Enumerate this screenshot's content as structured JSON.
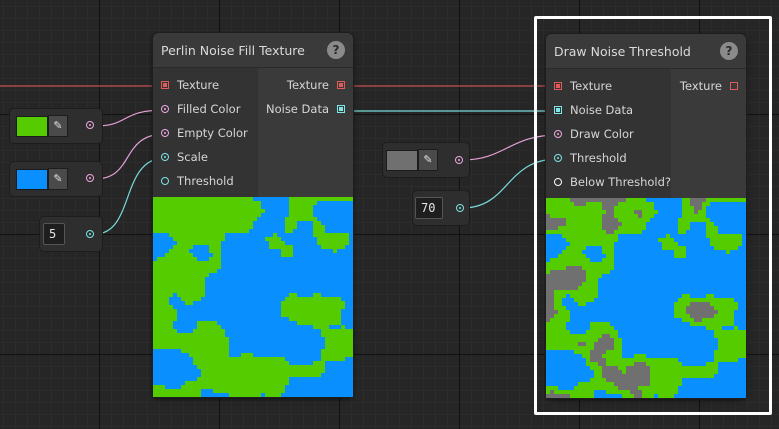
{
  "colors": {
    "texture": "#e05a5a",
    "noise": "#7ee6e6",
    "color": "#f0a8e0",
    "float": "#7ee6e6",
    "wire_texture": "#c45050",
    "wire_noise": "#78dada",
    "wire_color": "#e6a0d8",
    "fill_green": "#55cc00",
    "fill_blue": "#0a8fff",
    "fill_gray": "#707070"
  },
  "node_perlin": {
    "title": "Perlin Noise Fill Texture",
    "help_icon": "?",
    "inputs": [
      {
        "label": "Texture",
        "type": "texture"
      },
      {
        "label": "Filled Color",
        "type": "color"
      },
      {
        "label": "Empty Color",
        "type": "color"
      },
      {
        "label": "Scale",
        "type": "float"
      },
      {
        "label": "Threshold",
        "type": "float_empty"
      }
    ],
    "outputs": [
      {
        "label": "Texture",
        "type": "texture"
      },
      {
        "label": "Noise Data",
        "type": "noise"
      }
    ]
  },
  "node_threshold": {
    "title": "Draw Noise Threshold",
    "help_icon": "?",
    "inputs": [
      {
        "label": "Texture",
        "type": "texture"
      },
      {
        "label": "Noise Data",
        "type": "noise"
      },
      {
        "label": "Draw Color",
        "type": "color"
      },
      {
        "label": "Threshold",
        "type": "float"
      },
      {
        "label": "Below Threshold?",
        "type": "bool"
      }
    ],
    "outputs": [
      {
        "label": "Texture",
        "type": "texture_empty"
      }
    ]
  },
  "fields": {
    "filled_color": {
      "value": "#55cc00",
      "picker_icon": "eyedropper-icon"
    },
    "empty_color": {
      "value": "#0a8fff",
      "picker_icon": "eyedropper-icon"
    },
    "scale_value": "5",
    "draw_color": {
      "value": "#707070",
      "picker_icon": "eyedropper-icon"
    },
    "threshold_value": "70"
  }
}
